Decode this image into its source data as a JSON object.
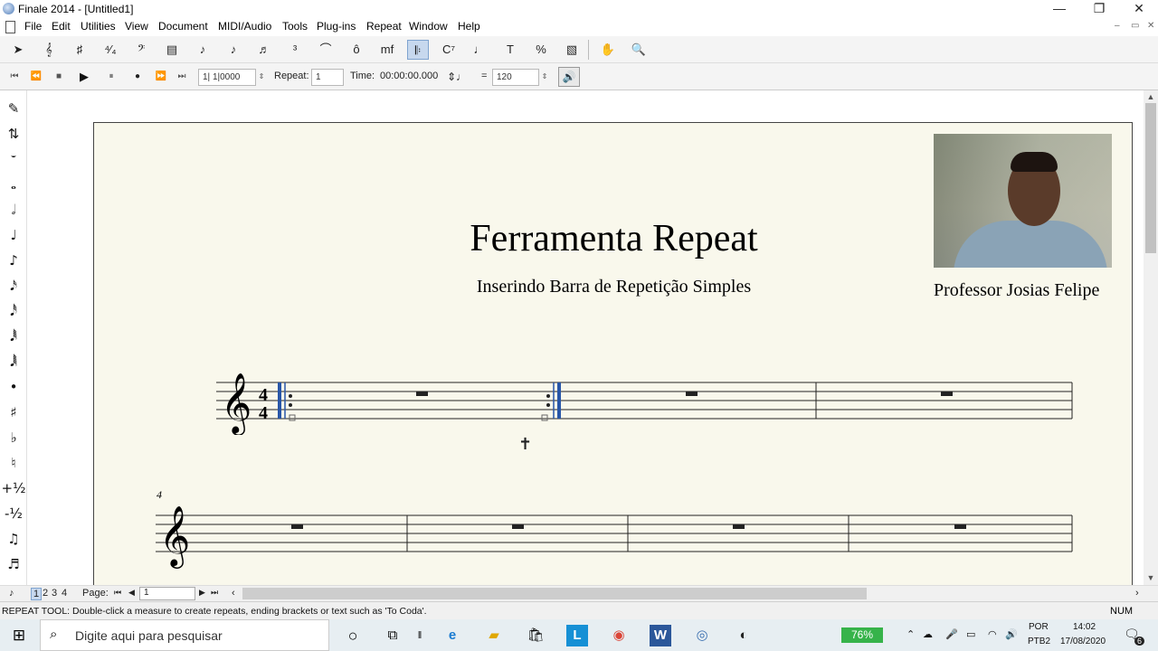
{
  "window": {
    "title": "Finale 2014 - [Untitled1]",
    "minimize": "—",
    "restore": "❐",
    "close": "✕"
  },
  "menu": [
    "File",
    "Edit",
    "Utilities",
    "View",
    "Document",
    "MIDI/Audio",
    "Tools",
    "Plug-ins",
    "Repeat",
    "Window",
    "Help"
  ],
  "mdi_controls": [
    "–",
    "▭",
    "✕"
  ],
  "toolbar_main": {
    "tools": [
      {
        "name": "selection-tool-icon",
        "glyph": "➤"
      },
      {
        "name": "staff-tool-icon",
        "glyph": "𝄞"
      },
      {
        "name": "key-signature-tool-icon",
        "glyph": "♯"
      },
      {
        "name": "time-signature-tool-icon",
        "glyph": "⁴⁄₄"
      },
      {
        "name": "clef-tool-icon",
        "glyph": "𝄢"
      },
      {
        "name": "measure-tool-icon",
        "glyph": "▤"
      },
      {
        "name": "simple-entry-tool-icon",
        "glyph": "♪"
      },
      {
        "name": "speedy-entry-tool-icon",
        "glyph": "♪"
      },
      {
        "name": "hyperscribe-tool-icon",
        "glyph": "♬"
      },
      {
        "name": "tuplet-tool-icon",
        "glyph": "³"
      },
      {
        "name": "smart-shape-tool-icon",
        "glyph": "⌒"
      },
      {
        "name": "articulation-tool-icon",
        "glyph": "ô"
      },
      {
        "name": "expression-tool-icon",
        "glyph": "mf"
      },
      {
        "name": "repeat-tool-icon",
        "glyph": "𝄆",
        "active": true
      },
      {
        "name": "chord-tool-icon",
        "glyph": "C⁷"
      },
      {
        "name": "lyrics-tool-icon",
        "glyph": "♩"
      },
      {
        "name": "text-tool-icon",
        "glyph": "T"
      },
      {
        "name": "resize-tool-icon",
        "glyph": "%"
      },
      {
        "name": "graphics-tool-icon",
        "glyph": "▧"
      },
      {
        "name": "hand-grabber-icon",
        "glyph": "✋"
      },
      {
        "name": "zoom-tool-icon",
        "glyph": "🔍"
      }
    ]
  },
  "playback": {
    "counter": "1| 1|0000",
    "repeat_label": "Repeat:",
    "repeat_value": "1",
    "time_label": "Time:",
    "time_value": "00:00:00.000",
    "equals": "=",
    "tempo": "120"
  },
  "palette": [
    "✎",
    "⇅",
    "𝄻",
    "𝅝",
    "𝅗𝅥",
    "♩",
    "♪",
    "𝅘𝅥𝅯",
    "𝅘𝅥𝅰",
    "𝅘𝅥𝅱",
    "𝅘𝅥𝅲",
    "•",
    "♯",
    "♭",
    "♮",
    "+½",
    "-½",
    "♫",
    "♬",
    "♪"
  ],
  "score": {
    "title": "Ferramenta Repeat",
    "subtitle": "Inserindo Barra de Repetição Simples",
    "composer": "Professor Josias Felipe",
    "measure_number": "4",
    "time_signature_top": "4",
    "time_signature_bottom": "4"
  },
  "page_strip": {
    "pages": [
      "1",
      "2",
      "3",
      "4"
    ],
    "page_label": "Page:",
    "page_value": "1"
  },
  "status": {
    "message": "REPEAT TOOL: Double-click a measure to create repeats, ending brackets or text such as 'To Coda'.",
    "num": "NUM"
  },
  "taskbar": {
    "search_placeholder": "Digite aqui para pesquisar",
    "battery": "76%",
    "lang1": "POR",
    "lang2": "PTB2",
    "time": "14:02",
    "date": "17/08/2020",
    "notifications": "6"
  }
}
